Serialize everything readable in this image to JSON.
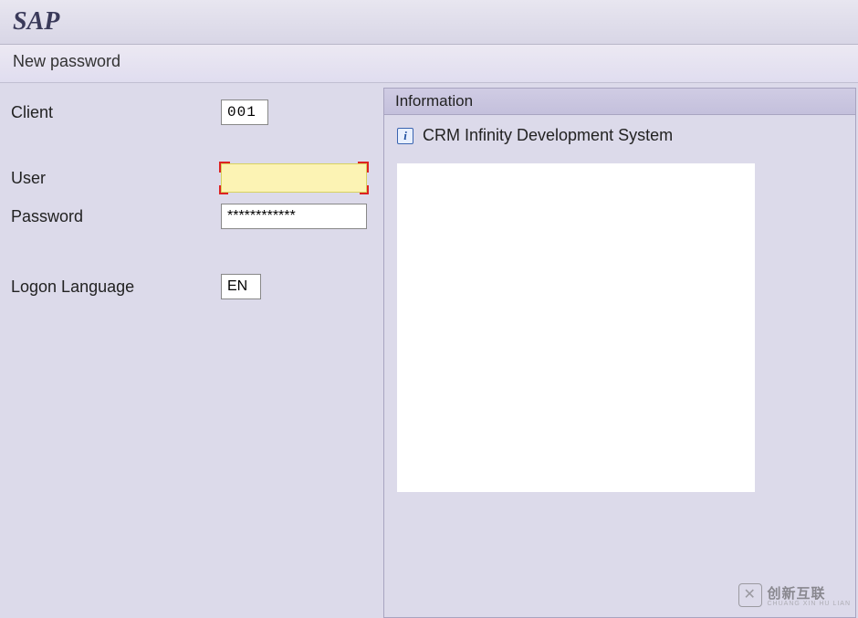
{
  "header": {
    "app_title": "SAP",
    "subtitle": "New password"
  },
  "form": {
    "client_label": "Client",
    "client_value": "001",
    "user_label": "User",
    "user_value": "",
    "password_label": "Password",
    "password_value": "************",
    "language_label": "Logon Language",
    "language_value": "EN"
  },
  "info": {
    "panel_title": "Information",
    "icon_glyph": "i",
    "system_text": "CRM Infinity Development System"
  },
  "watermark": {
    "brand": "创新互联",
    "sub": "CHUANG XIN HU LIAN"
  }
}
